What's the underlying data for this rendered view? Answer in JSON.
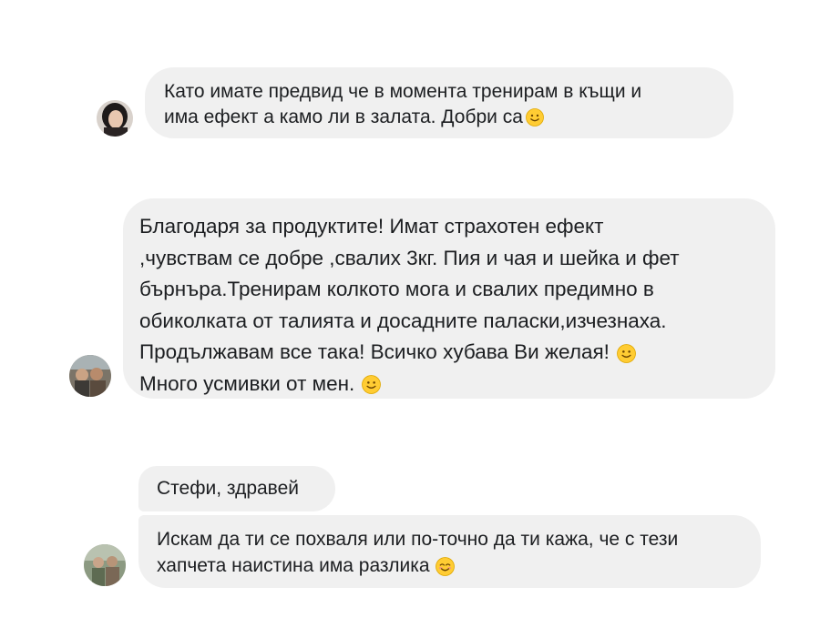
{
  "messages": [
    {
      "sender_avatar": "woman-dark-hair-avatar",
      "bubbles": [
        {
          "lines": [
            "Като имате предвид че в момента тренирам в къщи и",
            "има ефект а камо ли в залата. Добри са"
          ],
          "trailing_emoji": "slightly-smiling-face-emoji"
        }
      ]
    },
    {
      "sender_avatar": "group-photo-avatar",
      "bubbles": [
        {
          "lines": [
            "Благодаря за продуктите! Имат страхотен ефект",
            ",чувствам се добре ,свалих 3кг. Пия и чая и шейка и фет",
            "бърнъра.Тренирам колкото мога и свалих предимно в",
            "обиколката от талията и досадните паласки,изчезнаха.",
            "Продължавам все така! Всичко хубава Ви желая!",
            "Много усмивки от мен."
          ],
          "emoji_lines": [
            4,
            5
          ],
          "trailing_emoji": "slightly-smiling-face-emoji"
        }
      ]
    },
    {
      "sender_avatar": "outdoor-photo-avatar",
      "bubbles": [
        {
          "lines": [
            "Стефи, здравей"
          ]
        },
        {
          "lines": [
            "Искам да ти се похваля или по-точно да ти кажа, че с тези",
            "хапчета наистина има разлика"
          ],
          "trailing_emoji": "smiling-face-with-smiling-eyes-emoji"
        }
      ]
    }
  ],
  "colors": {
    "bubble_background": "#f0f0f0",
    "text": "#1c1e21",
    "emoji_yellow": "#ffcc33"
  }
}
